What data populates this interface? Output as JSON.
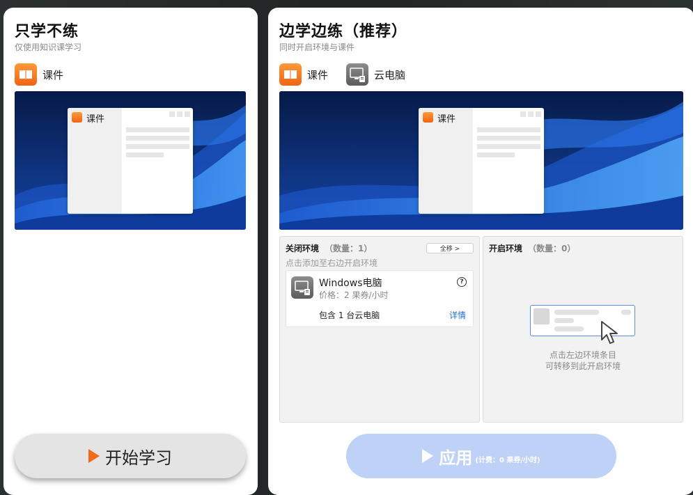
{
  "left_card": {
    "title": "只学不练",
    "subtitle": "仅使用知识课学习",
    "app_label": "课件",
    "preview_window_label": "课件",
    "start_button": "开始学习",
    "app_icon": "courseware-book-icon"
  },
  "right_card": {
    "title": "边学边练（推荐）",
    "subtitle": "同时开启环境与课件",
    "app_courseware_label": "课件",
    "app_cloud_pc_label": "云电脑",
    "preview_window_label": "课件",
    "closed_env": {
      "title": "关闭环境",
      "count": "（数量：1）",
      "hint": "点击添加至右边开启环境",
      "move_all": "全移 >",
      "item": {
        "name": "Windows电脑",
        "price": "价格：2 果券/小时",
        "includes": "包含 1 台云电脑",
        "detail": "详情",
        "help": "?"
      }
    },
    "open_env": {
      "title": "开启环境",
      "count": "（数量：0）",
      "hint_line1": "点击左边环境条目",
      "hint_line2": "可转移到此开启环境"
    },
    "apply_button": "应用",
    "apply_billing": "(计费：0 果券/小时)"
  },
  "colors": {
    "accent_orange": "#f06a1a",
    "link_blue": "#1f6fd1",
    "apply_disabled": "#bed2f8"
  }
}
